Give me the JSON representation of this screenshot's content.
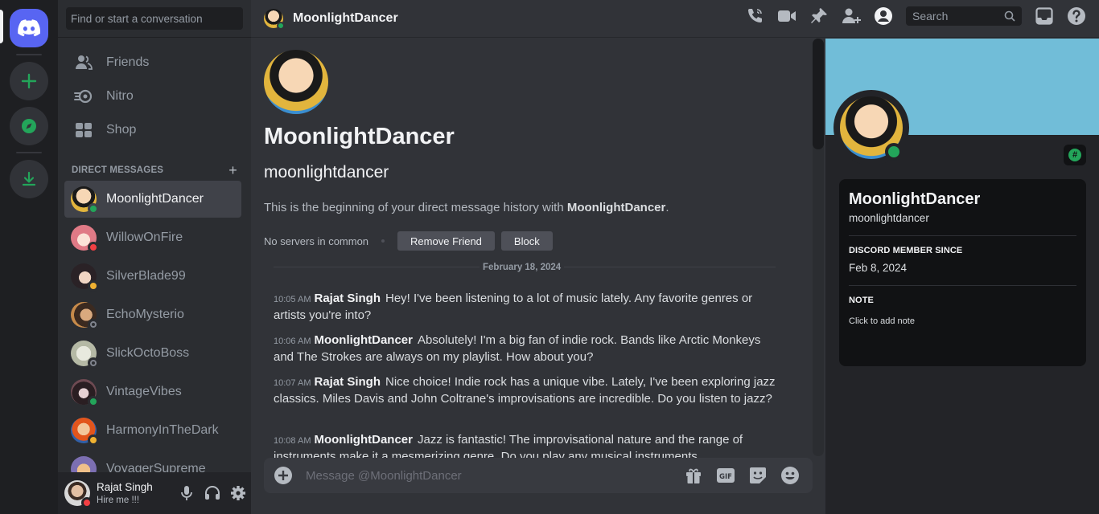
{
  "sidebar": {
    "search_placeholder": "Find or start a conversation",
    "nav": [
      {
        "label": "Friends",
        "icon": "friends-icon"
      },
      {
        "label": "Nitro",
        "icon": "nitro-icon"
      },
      {
        "label": "Shop",
        "icon": "shop-icon"
      }
    ],
    "dm_header": "DIRECT MESSAGES",
    "dms": [
      {
        "name": "MoonlightDancer",
        "status": "online",
        "active": true
      },
      {
        "name": "WillowOnFire",
        "status": "dnd"
      },
      {
        "name": "SilverBlade99",
        "status": "idle"
      },
      {
        "name": "EchoMysterio",
        "status": "offline"
      },
      {
        "name": "SlickOctoBoss",
        "status": "offline"
      },
      {
        "name": "VintageVibes",
        "status": "online"
      },
      {
        "name": "HarmonyInTheDark",
        "status": "idle"
      },
      {
        "name": "VoyagerSupreme",
        "status": "offline"
      }
    ],
    "user": {
      "name": "Rajat Singh",
      "status_text": "Hire me !!!",
      "status": "dnd"
    }
  },
  "topbar": {
    "title": "MoonlightDancer",
    "search_placeholder": "Search"
  },
  "chat": {
    "welcome_title": "MoonlightDancer",
    "welcome_handle": "moonlightdancer",
    "welcome_desc_prefix": "This is the beginning of your direct message history with ",
    "welcome_desc_name": "MoonlightDancer",
    "welcome_desc_suffix": ".",
    "no_servers": "No servers in common",
    "remove_friend": "Remove Friend",
    "block": "Block",
    "date_divider": "February 18, 2024",
    "messages": [
      {
        "time": "10:05 AM",
        "author": "Rajat Singh",
        "text": "Hey! I've been listening to a lot of music lately. Any favorite genres or artists you're into?"
      },
      {
        "time": "10:06 AM",
        "author": "MoonlightDancer",
        "text": "Absolutely! I'm a big fan of indie rock. Bands like Arctic Monkeys and The Strokes are always on my playlist. How about you?"
      },
      {
        "time": "10:07 AM",
        "author": "Rajat Singh",
        "text": "Nice choice! Indie rock has a unique vibe. Lately, I've been exploring jazz classics. Miles Davis and John Coltrane's improvisations are incredible. Do you listen to jazz?"
      },
      {
        "time": "10:08 AM",
        "author": "MoonlightDancer",
        "text": "Jazz is fantastic! The improvisational nature and the range of instruments make it a mesmerizing genre. Do you play any musical instruments"
      }
    ],
    "composer_placeholder": "Message @MoonlightDancer"
  },
  "profile": {
    "name": "MoonlightDancer",
    "handle": "moonlightdancer",
    "member_since_label": "DISCORD MEMBER SINCE",
    "member_since": "Feb 8, 2024",
    "note_label": "NOTE",
    "note_placeholder": "Click to add note",
    "badge": "#",
    "banner_color": "#71bdd8"
  },
  "colors": {
    "brand": "#5865f2",
    "online": "#23a55a",
    "dnd": "#f23f43",
    "idle": "#f0b232",
    "offline": "#80848e"
  }
}
